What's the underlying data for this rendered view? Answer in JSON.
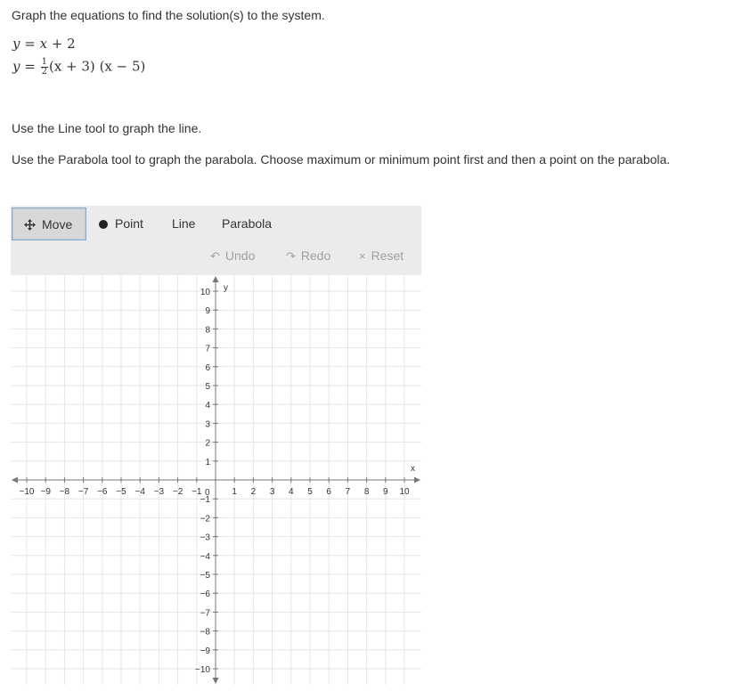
{
  "prompt": "Graph the equations to find the solution(s) to the system.",
  "equations": {
    "line": {
      "lhs": "y",
      "rhs_var": "x",
      "rhs_rest": "+ 2"
    },
    "parabola": {
      "lhs": "y",
      "num": "1",
      "den": "2",
      "factor1": "(x + 3)",
      "factor2": "(x − 5)"
    }
  },
  "instructions": {
    "line": "Use the Line tool to graph the line.",
    "parabola": "Use the Parabola tool to graph the parabola. Choose maximum or minimum point first and then a point on the parabola."
  },
  "toolbar": {
    "move_label": "Move",
    "point_label": "Point",
    "line_label": "Line",
    "parabola_label": "Parabola",
    "undo_label": "Undo",
    "redo_label": "Redo",
    "reset_label": "Reset",
    "active_tool": "Move"
  },
  "graph": {
    "x_axis_label": "x",
    "y_axis_label": "y",
    "x_range": [
      -10,
      10
    ],
    "y_range": [
      -10,
      10
    ],
    "grid": true,
    "origin_label": "0",
    "x_ticks": [
      "−10",
      "−9",
      "−8",
      "−7",
      "−6",
      "−5",
      "−4",
      "−3",
      "−2",
      "−1",
      "1",
      "2",
      "3",
      "4",
      "5",
      "6",
      "7",
      "8",
      "9",
      "10"
    ],
    "y_ticks": [
      "10",
      "9",
      "8",
      "7",
      "6",
      "5",
      "4",
      "3",
      "2",
      "1",
      "−1",
      "−2",
      "−3",
      "−4",
      "−5",
      "−6",
      "−7",
      "−8",
      "−9",
      "−10"
    ],
    "colors": {
      "grid": "#e6e6e6",
      "axis": "#777777",
      "active_border": "#7fa7cf",
      "toolbar_bg": "#ebebeb"
    }
  }
}
